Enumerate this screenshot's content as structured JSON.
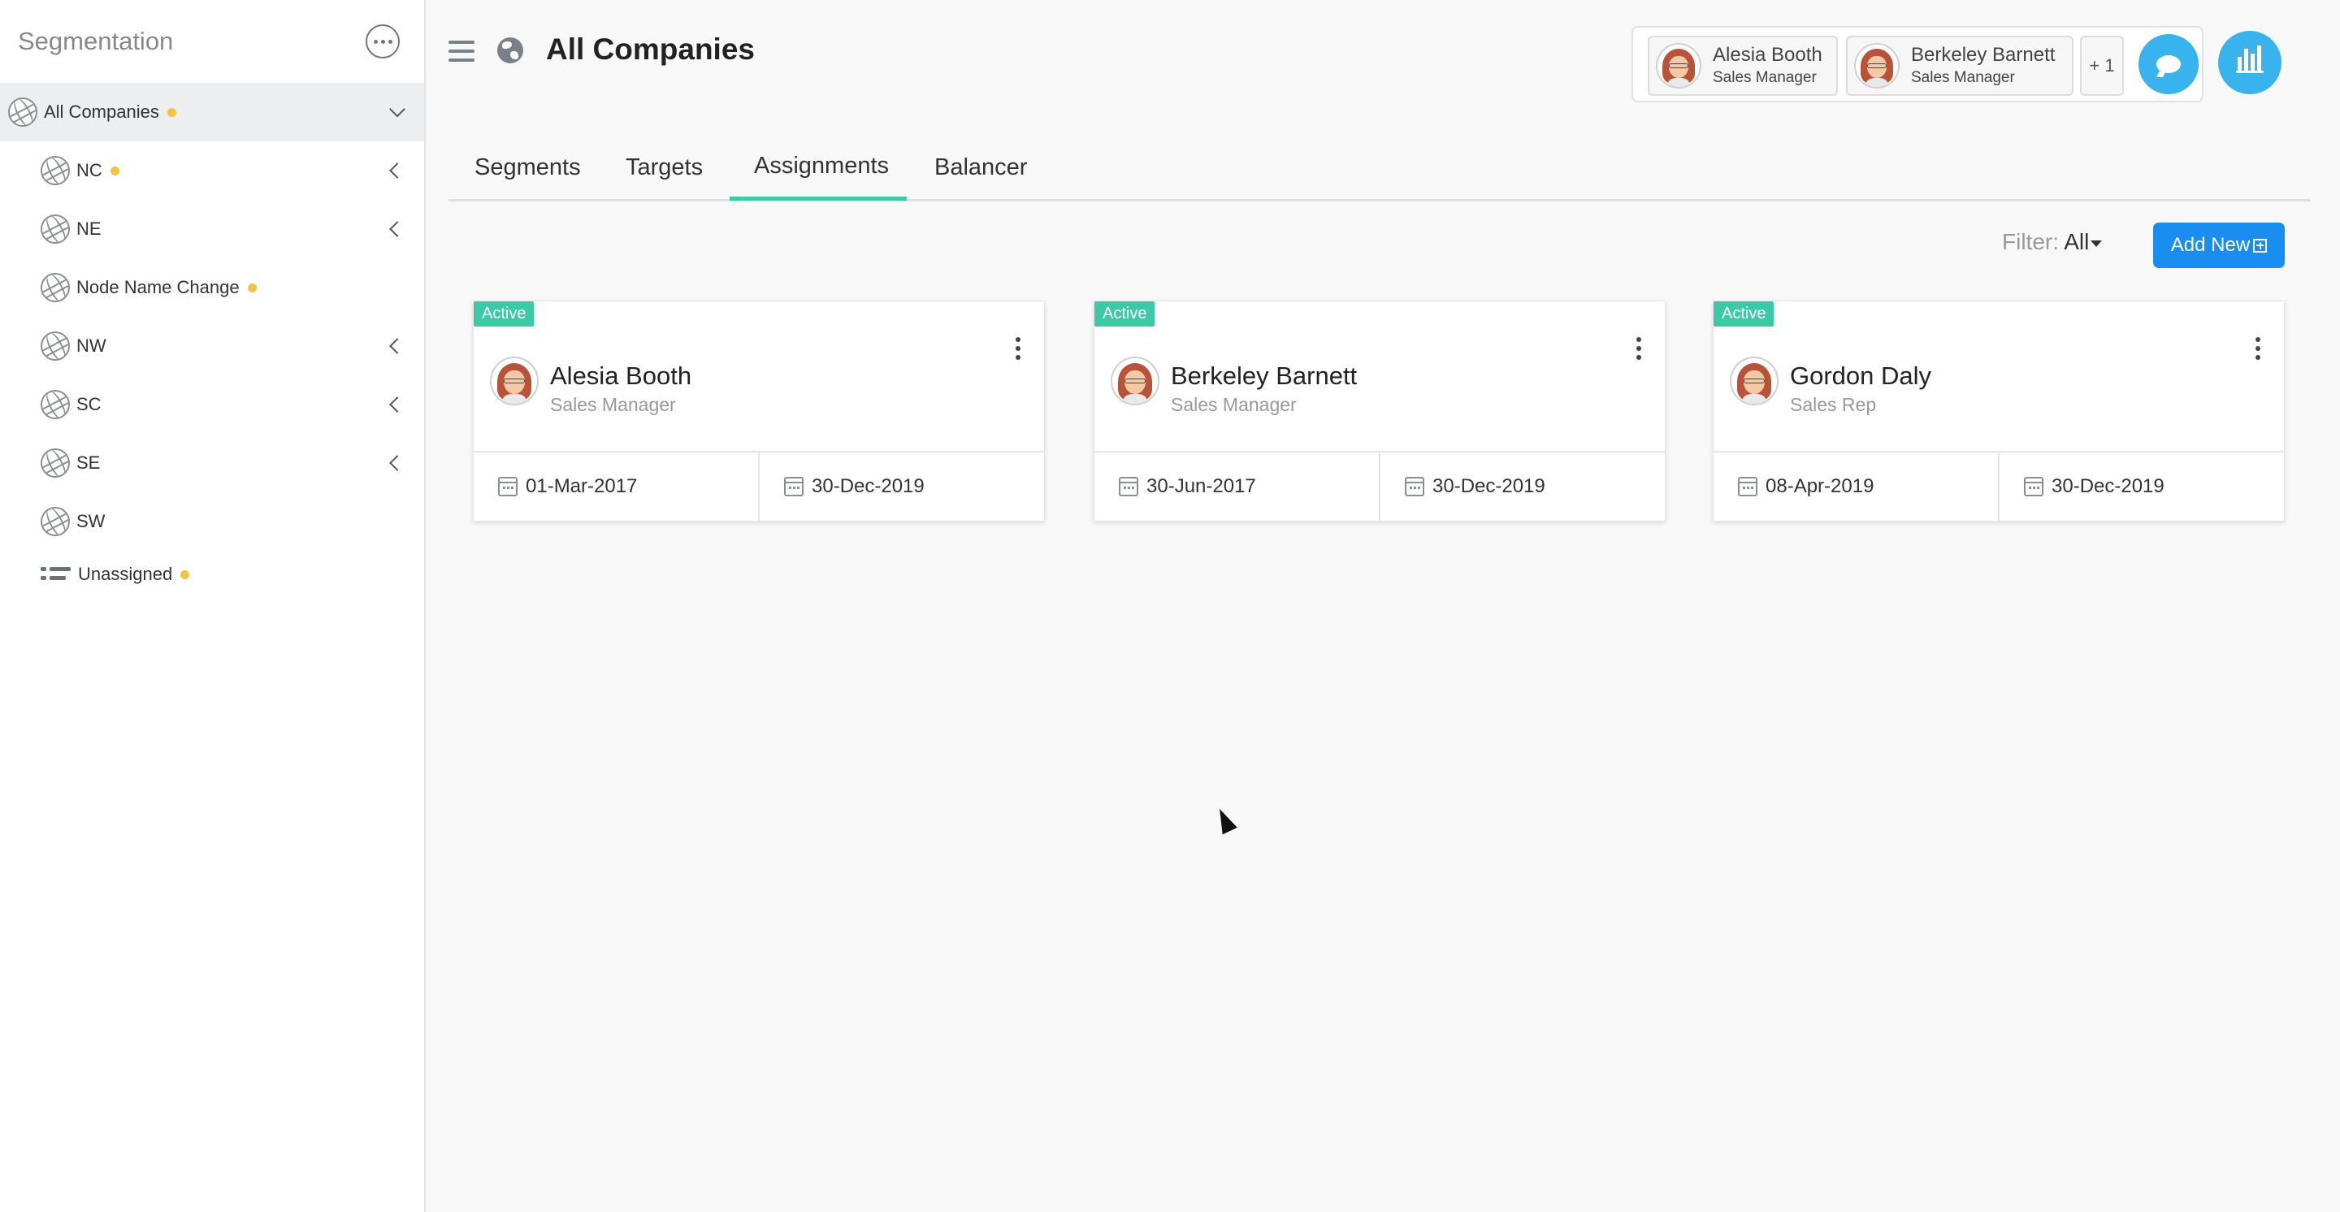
{
  "sidebar": {
    "title": "Segmentation",
    "more_icon": "ellipsis-circle-icon",
    "items": [
      {
        "label": "All Companies",
        "icon": "globe-icon",
        "dot": true,
        "chevron": "down"
      },
      {
        "label": "NC",
        "icon": "globe-icon",
        "dot": true,
        "chevron": "left"
      },
      {
        "label": "NE",
        "icon": "globe-icon",
        "dot": false,
        "chevron": "left"
      },
      {
        "label": "Node Name Change",
        "icon": "globe-icon",
        "dot": true,
        "chevron": ""
      },
      {
        "label": "NW",
        "icon": "globe-icon",
        "dot": false,
        "chevron": "left"
      },
      {
        "label": "SC",
        "icon": "globe-icon",
        "dot": false,
        "chevron": "left"
      },
      {
        "label": "SE",
        "icon": "globe-icon",
        "dot": false,
        "chevron": "left"
      },
      {
        "label": "SW",
        "icon": "globe-icon",
        "dot": false,
        "chevron": ""
      },
      {
        "label": "Unassigned",
        "icon": "list-icon",
        "dot": true,
        "chevron": ""
      }
    ]
  },
  "header": {
    "title": "All Companies",
    "users": [
      {
        "name": "Alesia Booth",
        "role": "Sales Manager"
      },
      {
        "name": "Berkeley Barnett",
        "role": "Sales Manager"
      }
    ],
    "more_users": "+ 1"
  },
  "tabs": [
    {
      "label": "Segments",
      "active": false
    },
    {
      "label": "Targets",
      "active": false
    },
    {
      "label": "Assignments",
      "active": true
    },
    {
      "label": "Balancer",
      "active": false
    }
  ],
  "toolbar": {
    "filter_label": "Filter:",
    "filter_value": "All",
    "add_label": "Add New"
  },
  "cards": [
    {
      "status": "Active",
      "name": "Alesia Booth",
      "role": "Sales Manager",
      "start": "01-Mar-2017",
      "end": "30-Dec-2019"
    },
    {
      "status": "Active",
      "name": "Berkeley Barnett",
      "role": "Sales Manager",
      "start": "30-Jun-2017",
      "end": "30-Dec-2019"
    },
    {
      "status": "Active",
      "name": "Gordon Daly",
      "role": "Sales Rep",
      "start": "08-Apr-2019",
      "end": "30-Dec-2019"
    }
  ],
  "colors": {
    "accent_green": "#3cc9a6",
    "primary_blue": "#1a8df0",
    "action_cyan": "#39b3ed",
    "status_dot": "#f5c242"
  }
}
